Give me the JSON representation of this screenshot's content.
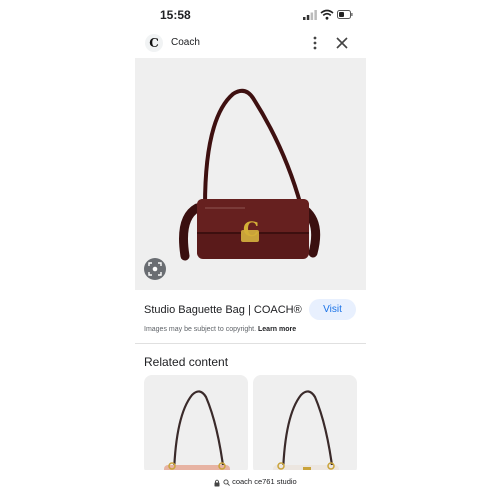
{
  "status_bar": {
    "time": "15:58",
    "icons": [
      "signal-icon",
      "wifi-icon",
      "battery-icon"
    ]
  },
  "header": {
    "site_logo_letter": "C",
    "site_name": "Coach",
    "icons": [
      "more-vert-icon",
      "close-icon"
    ]
  },
  "image": {
    "subject": "burgundy shoulder bag with gold turnlock",
    "lens_icon": "google-lens-icon",
    "colors": {
      "bag": "#5a1a1a",
      "hardware": "#c9a33a",
      "background": "#efefef"
    }
  },
  "result": {
    "title": "Studio Baguette Bag | COACH®",
    "visit_label": "Visit",
    "copyright_text": "Images may be subject to copyright.",
    "learn_more_label": "Learn more"
  },
  "related": {
    "title": "Related content",
    "cards": [
      {
        "color": "#e7b3a3"
      },
      {
        "color": "#ece6e0"
      }
    ]
  },
  "bottom_bar": {
    "url_text": "coach ce761 studio",
    "icons": [
      "lock-icon",
      "search-icon"
    ]
  },
  "colors": {
    "accent": "#1a73e8",
    "visit_bg": "#e8f0fe"
  }
}
